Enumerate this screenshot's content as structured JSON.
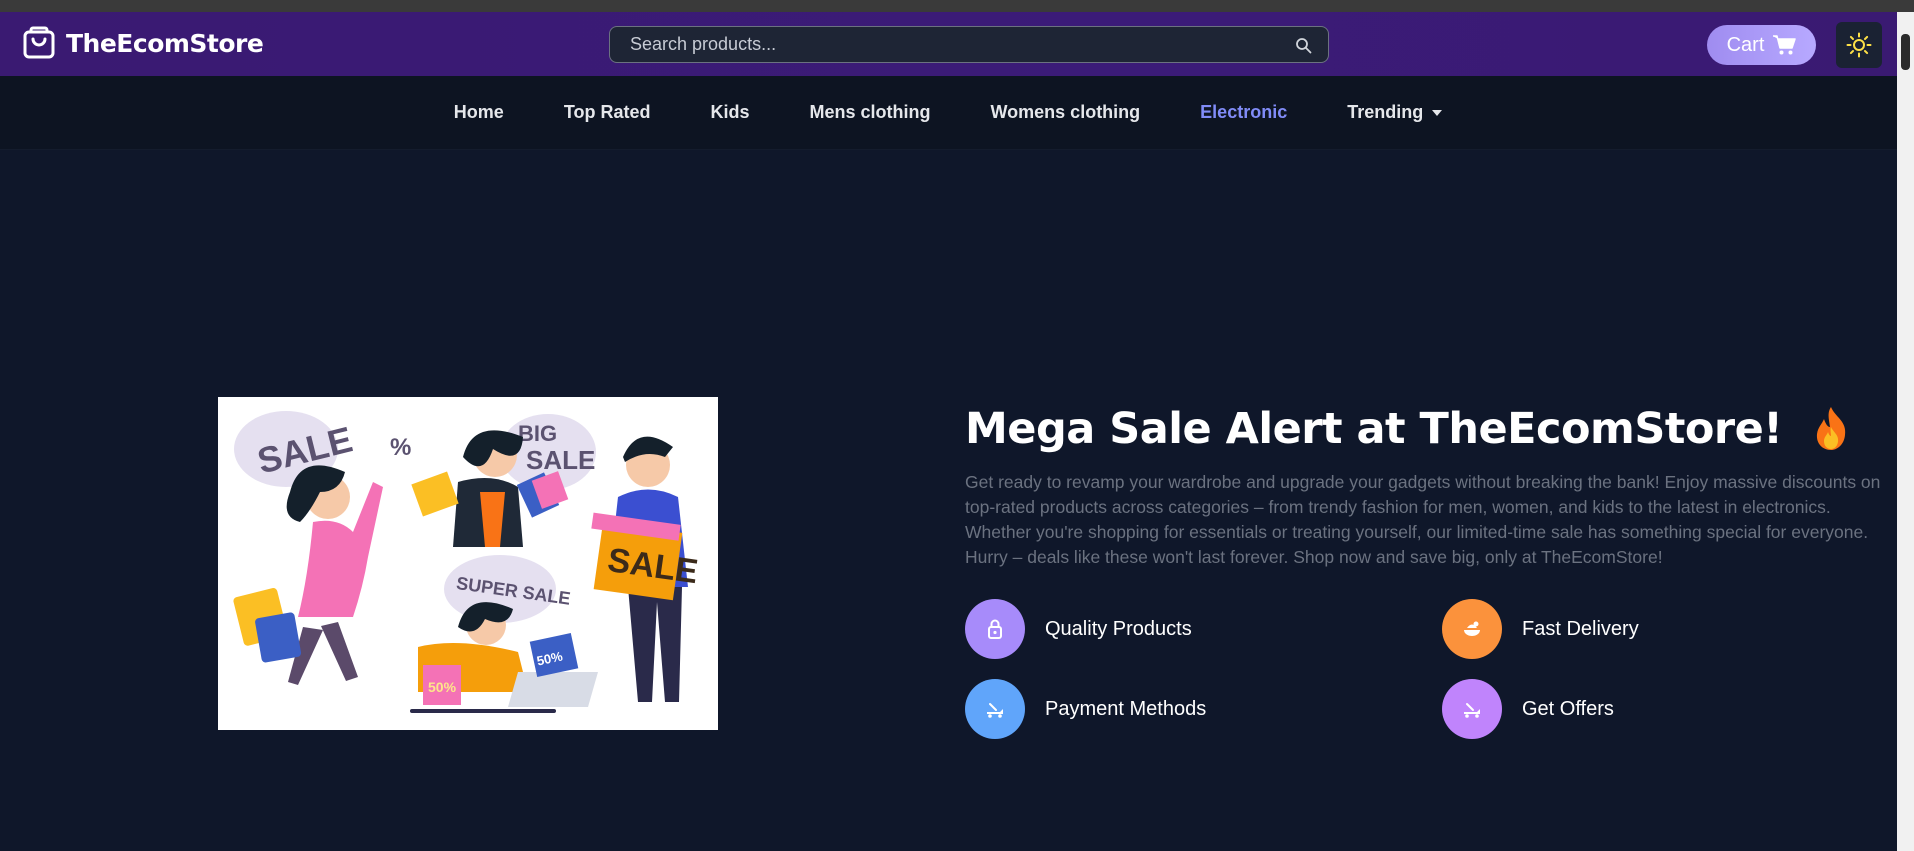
{
  "header": {
    "brand_name": "TheEcomStore",
    "search_placeholder": "Search products...",
    "cart_label": "Cart"
  },
  "nav": {
    "items": [
      {
        "label": "Home"
      },
      {
        "label": "Top Rated"
      },
      {
        "label": "Kids"
      },
      {
        "label": "Mens clothing"
      },
      {
        "label": "Womens clothing"
      },
      {
        "label": "Electronic"
      },
      {
        "label": "Trending"
      }
    ],
    "active": "Electronic"
  },
  "hero": {
    "title": "Mega Sale Alert at TheEcomStore!",
    "description": "Get ready to revamp your wardrobe and upgrade your gadgets without breaking the bank! Enjoy massive discounts on top-rated products across categories – from trendy fashion for men, women, and kids to the latest in electronics. Whether you're shopping for essentials or treating yourself, our limited-time sale has something special for everyone. Hurry – deals like these won't last forever. Shop now and save big, only at TheEcomStore!",
    "image_text": {
      "sale": "SALE",
      "big_sale_1": "BIG",
      "big_sale_2": "SALE",
      "super_sale": "SUPER SALE",
      "gift_sale": "SALE",
      "percent": "%",
      "bag_50a": "50%",
      "bag_50b": "50%"
    }
  },
  "features": [
    {
      "label": "Quality Products",
      "icon": "lock-icon",
      "color": "#a78bfa"
    },
    {
      "label": "Fast Delivery",
      "icon": "food-icon",
      "color": "#fb923c"
    },
    {
      "label": "Payment Methods",
      "icon": "delivery-icon",
      "color": "#60a5fa"
    },
    {
      "label": "Get Offers",
      "icon": "offer-icon",
      "color": "#c084fc"
    }
  ],
  "colors": {
    "header_bg": "#3a1a72",
    "page_bg": "#0f172a",
    "nav_bg": "#0d1422",
    "accent": "#818cf8",
    "cart_button": "#a996f5"
  }
}
